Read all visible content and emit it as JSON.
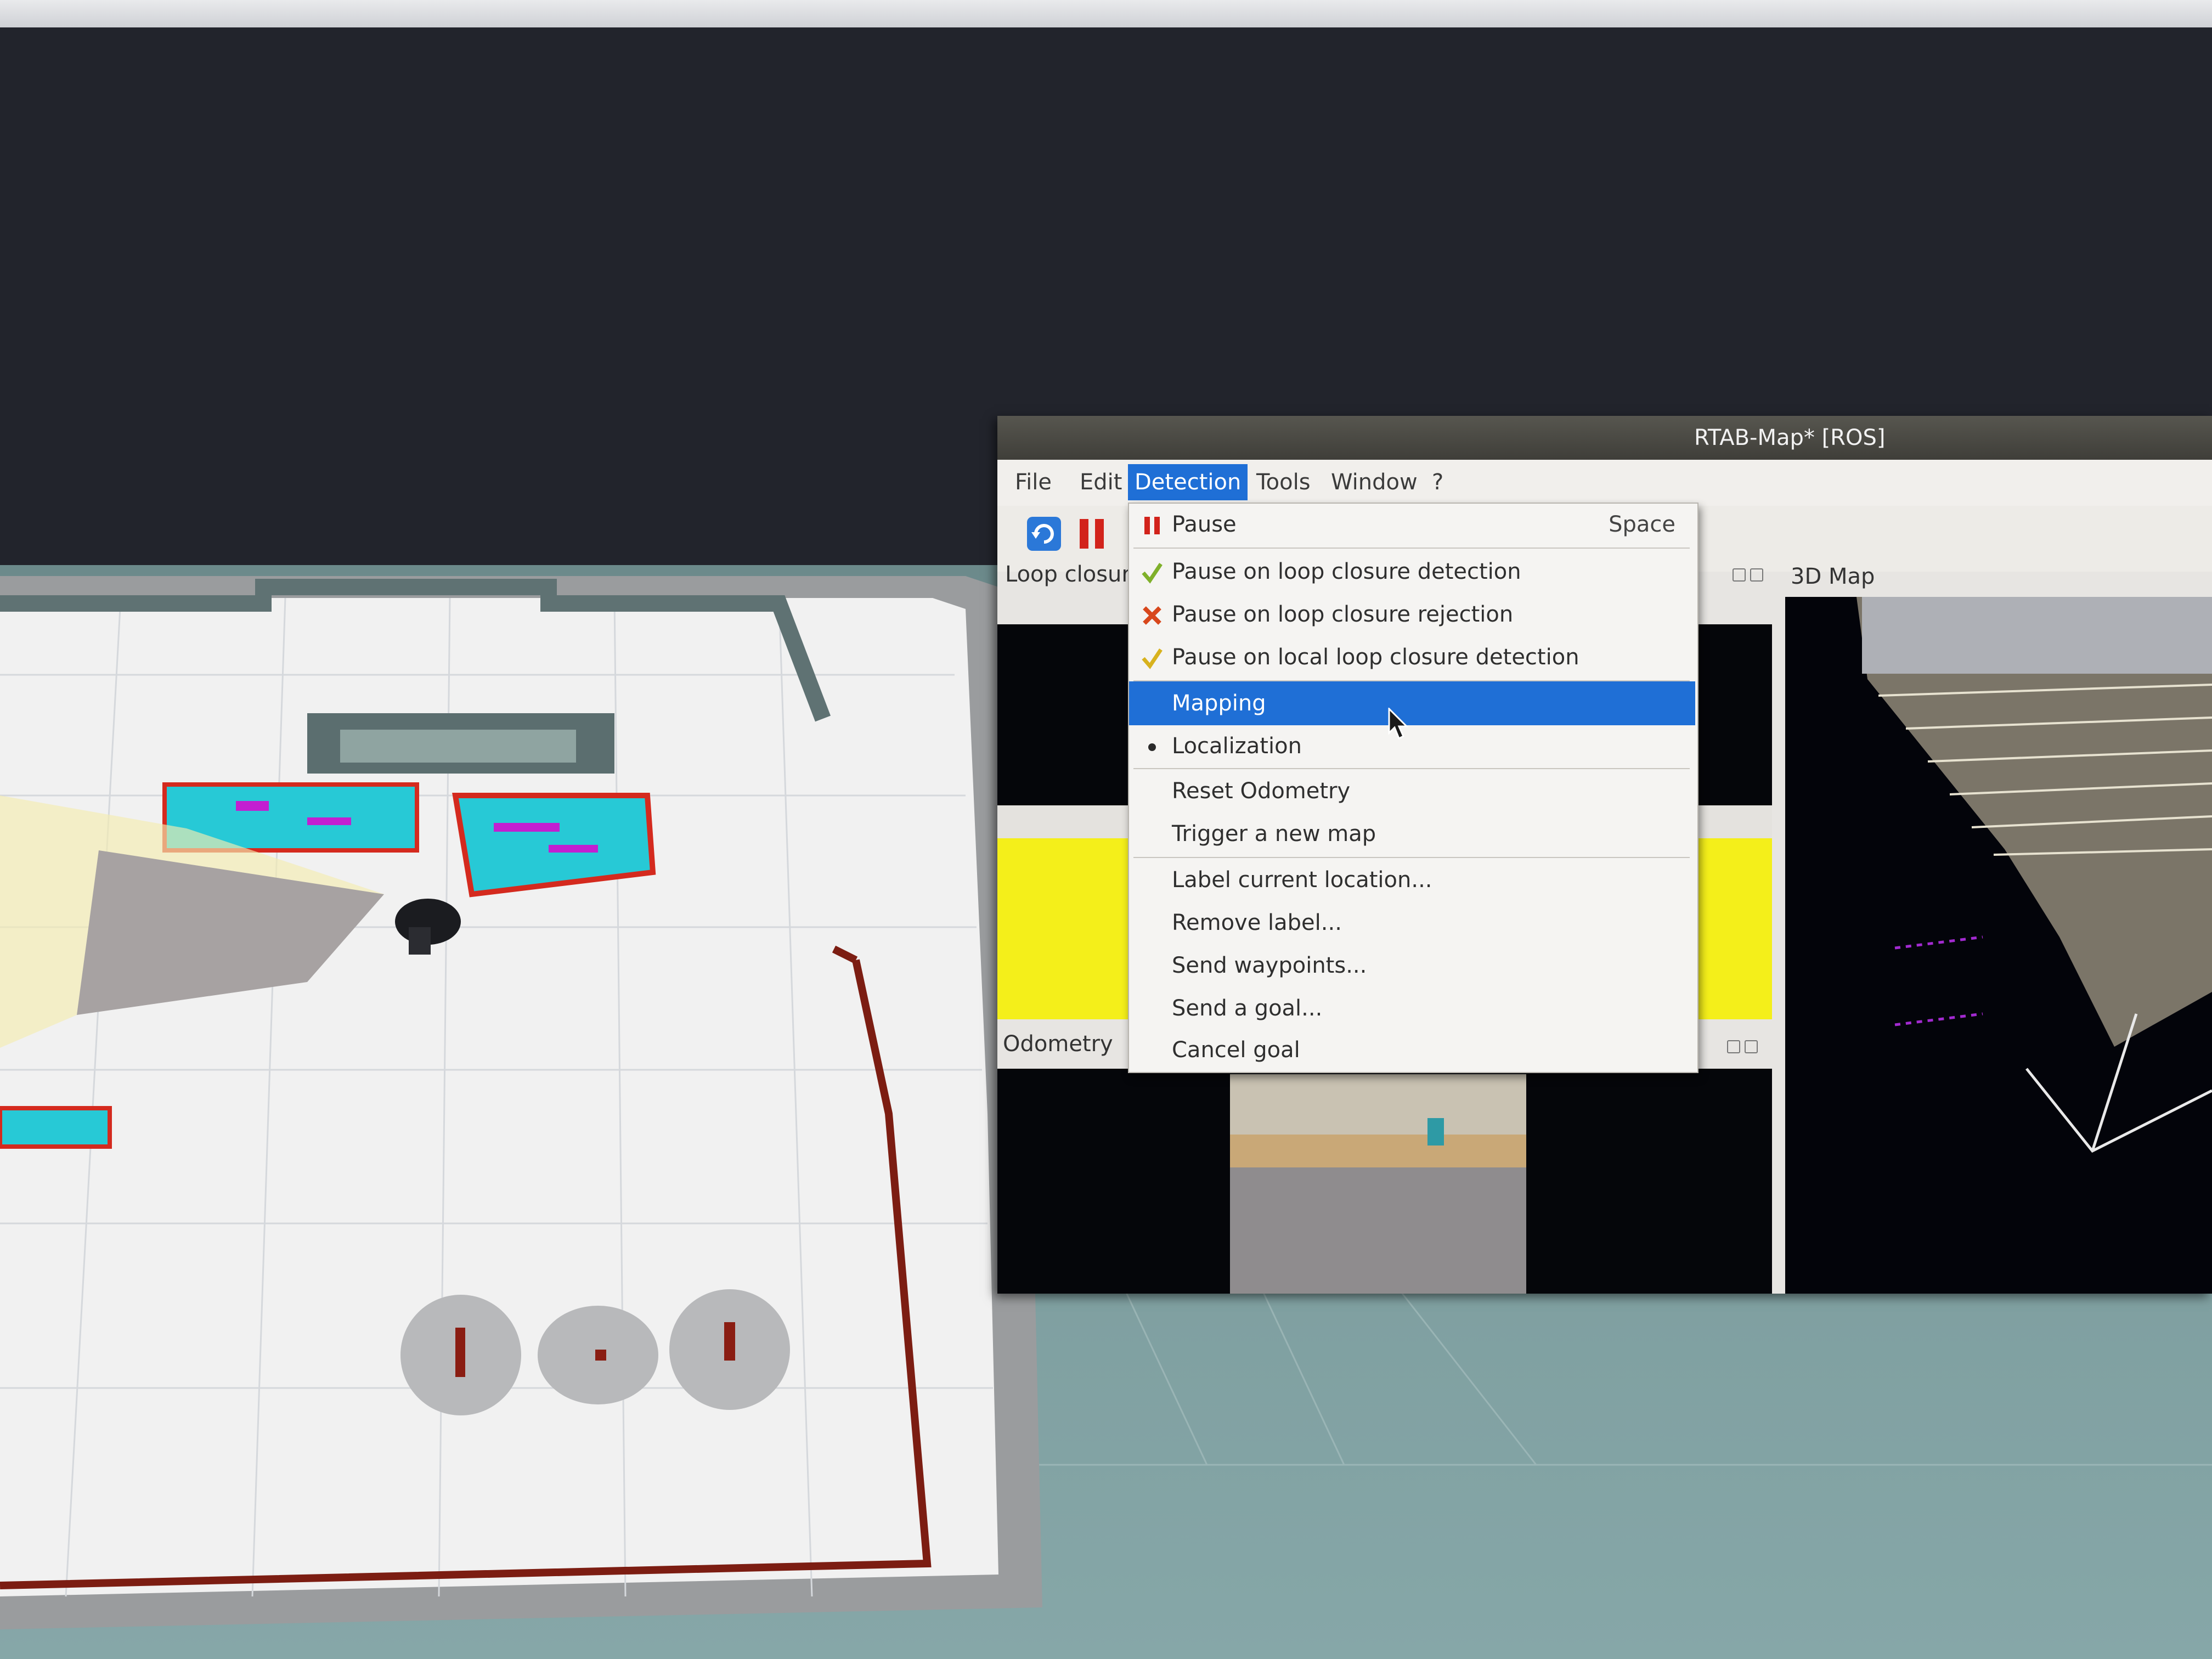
{
  "window": {
    "title": "RTAB-Map* [ROS]"
  },
  "menubar": {
    "items": [
      {
        "label": "File"
      },
      {
        "label": "Edit"
      },
      {
        "label": "Detection"
      },
      {
        "label": "Tools"
      },
      {
        "label": "Window"
      },
      {
        "label": "?"
      }
    ],
    "active": "Detection"
  },
  "docks": {
    "loop_closure": "Loop closure",
    "map_3d": "3D Map",
    "odometry": "Odometry"
  },
  "detection_menu": {
    "items": [
      {
        "label": "Pause",
        "shortcut": "Space",
        "icon": "pause-icon"
      },
      {
        "label": "Pause on loop closure detection",
        "icon": "check-icon"
      },
      {
        "label": "Pause on loop closure rejection",
        "icon": "x-mark-icon"
      },
      {
        "label": "Pause on local loop closure detection",
        "icon": "check-icon"
      },
      {
        "label": "Mapping",
        "selected": true
      },
      {
        "label": "Localization",
        "checked": true
      },
      {
        "label": "Reset Odometry"
      },
      {
        "label": "Trigger a new map"
      },
      {
        "label": "Label current location..."
      },
      {
        "label": "Remove label..."
      },
      {
        "label": "Send waypoints..."
      },
      {
        "label": "Send a goal..."
      },
      {
        "label": "Cancel goal"
      }
    ]
  },
  "colors": {
    "selection": "#1f6fd6",
    "pause_red": "#d2231b",
    "check_green": "#7fb02a",
    "reject_red": "#d8471c",
    "panel_yellow": "#f4ef1a"
  }
}
